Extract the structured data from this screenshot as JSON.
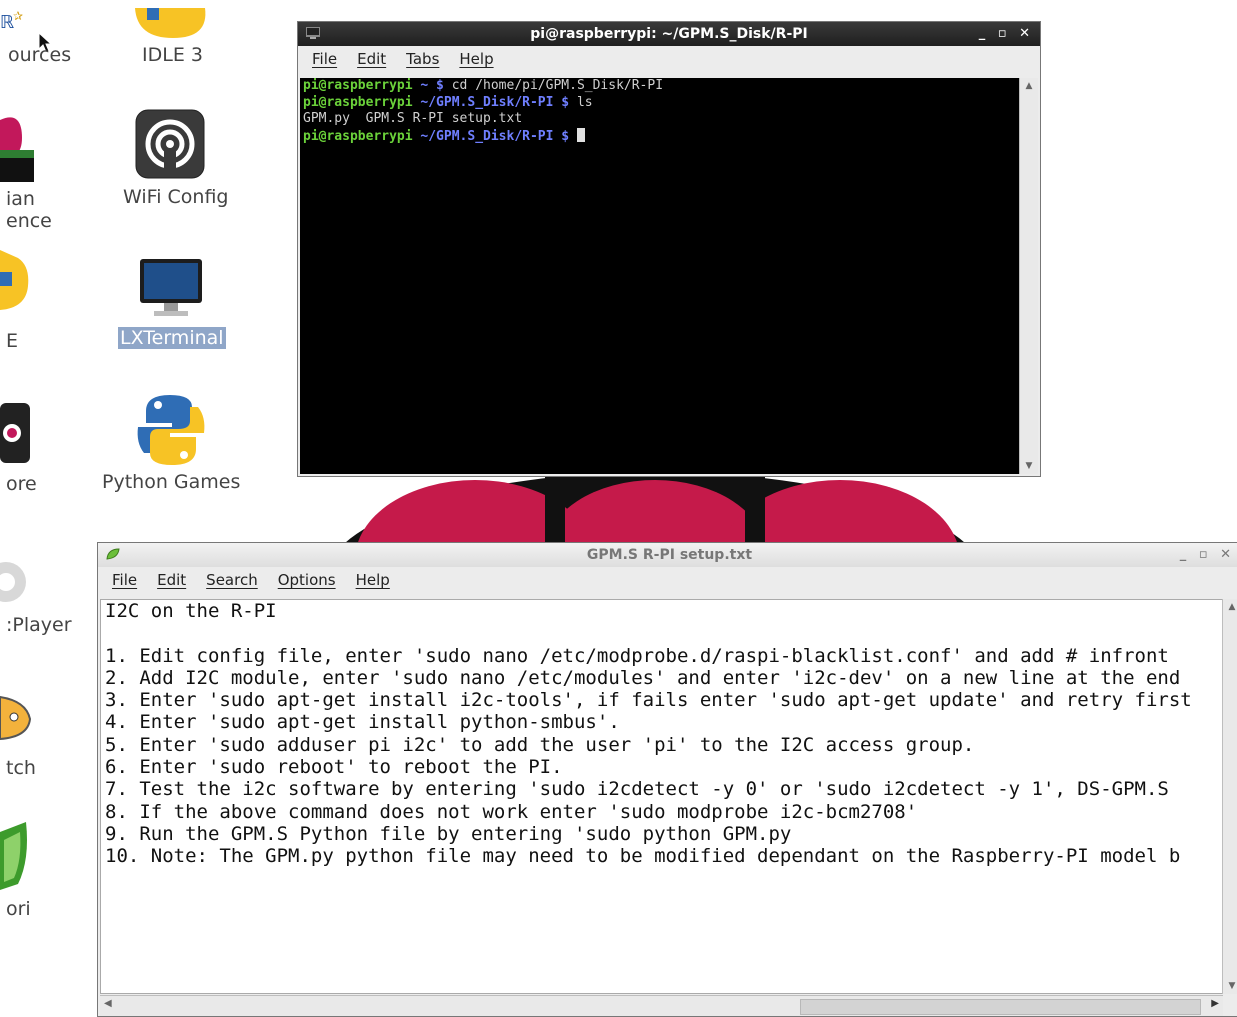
{
  "desktop": {
    "icons": [
      {
        "label": "ources"
      },
      {
        "label": "IDLE 3"
      },
      {
        "label": "ian"
      },
      {
        "label": "ence"
      },
      {
        "label": "WiFi Config"
      },
      {
        "label": "E"
      },
      {
        "label": "LXTerminal"
      },
      {
        "label": "ore"
      },
      {
        "label": "Python Games"
      },
      {
        "label": ":Player"
      },
      {
        "label": "tch"
      },
      {
        "label": "ori"
      }
    ]
  },
  "terminal": {
    "title": "pi@raspberrypi: ~/GPM.S_Disk/R-PI",
    "controls": "_ ▫ ✕",
    "menu": [
      "File",
      "Edit",
      "Tabs",
      "Help"
    ],
    "lines": [
      {
        "user": "pi@raspberrypi",
        "path": " ~ $ ",
        "cmd": "cd /home/pi/GPM.S_Disk/R-PI"
      },
      {
        "user": "pi@raspberrypi",
        "path": " ~/GPM.S_Disk/R-PI $ ",
        "cmd": "ls"
      },
      {
        "user": "",
        "path": "",
        "cmd": "GPM.py  GPM.S R-PI setup.txt"
      },
      {
        "user": "pi@raspberrypi",
        "path": " ~/GPM.S_Disk/R-PI $ ",
        "cmd": ""
      }
    ]
  },
  "editor": {
    "title": "GPM.S R-PI setup.txt",
    "controls": "_ ▫ ✕",
    "menu": [
      "File",
      "Edit",
      "Search",
      "Options",
      "Help"
    ],
    "lines": [
      "I2C on the R-PI",
      "",
      "1. Edit config file, enter 'sudo nano /etc/modprobe.d/raspi-blacklist.conf' and add # infront",
      "2. Add I2C module, enter 'sudo nano /etc/modules' and enter 'i2c-dev' on a new line at the end",
      "3. Enter 'sudo apt-get install i2c-tools', if fails enter 'sudo apt-get update' and retry first",
      "4. Enter 'sudo apt-get install python-smbus'.",
      "5. Enter 'sudo adduser pi i2c' to add the user 'pi' to the I2C access group.",
      "6. Enter 'sudo reboot' to reboot the PI.",
      "7. Test the i2c software by entering 'sudo i2cdetect -y 0' or 'sudo i2cdetect -y 1', DS-GPM.S",
      "8. If the above command does not work enter 'sudo modprobe i2c-bcm2708'",
      "9. Run the GPM.S Python file by entering 'sudo python GPM.py",
      "10. Note: The GPM.py python file may need to be modified dependant on the Raspberry-PI model b"
    ]
  }
}
